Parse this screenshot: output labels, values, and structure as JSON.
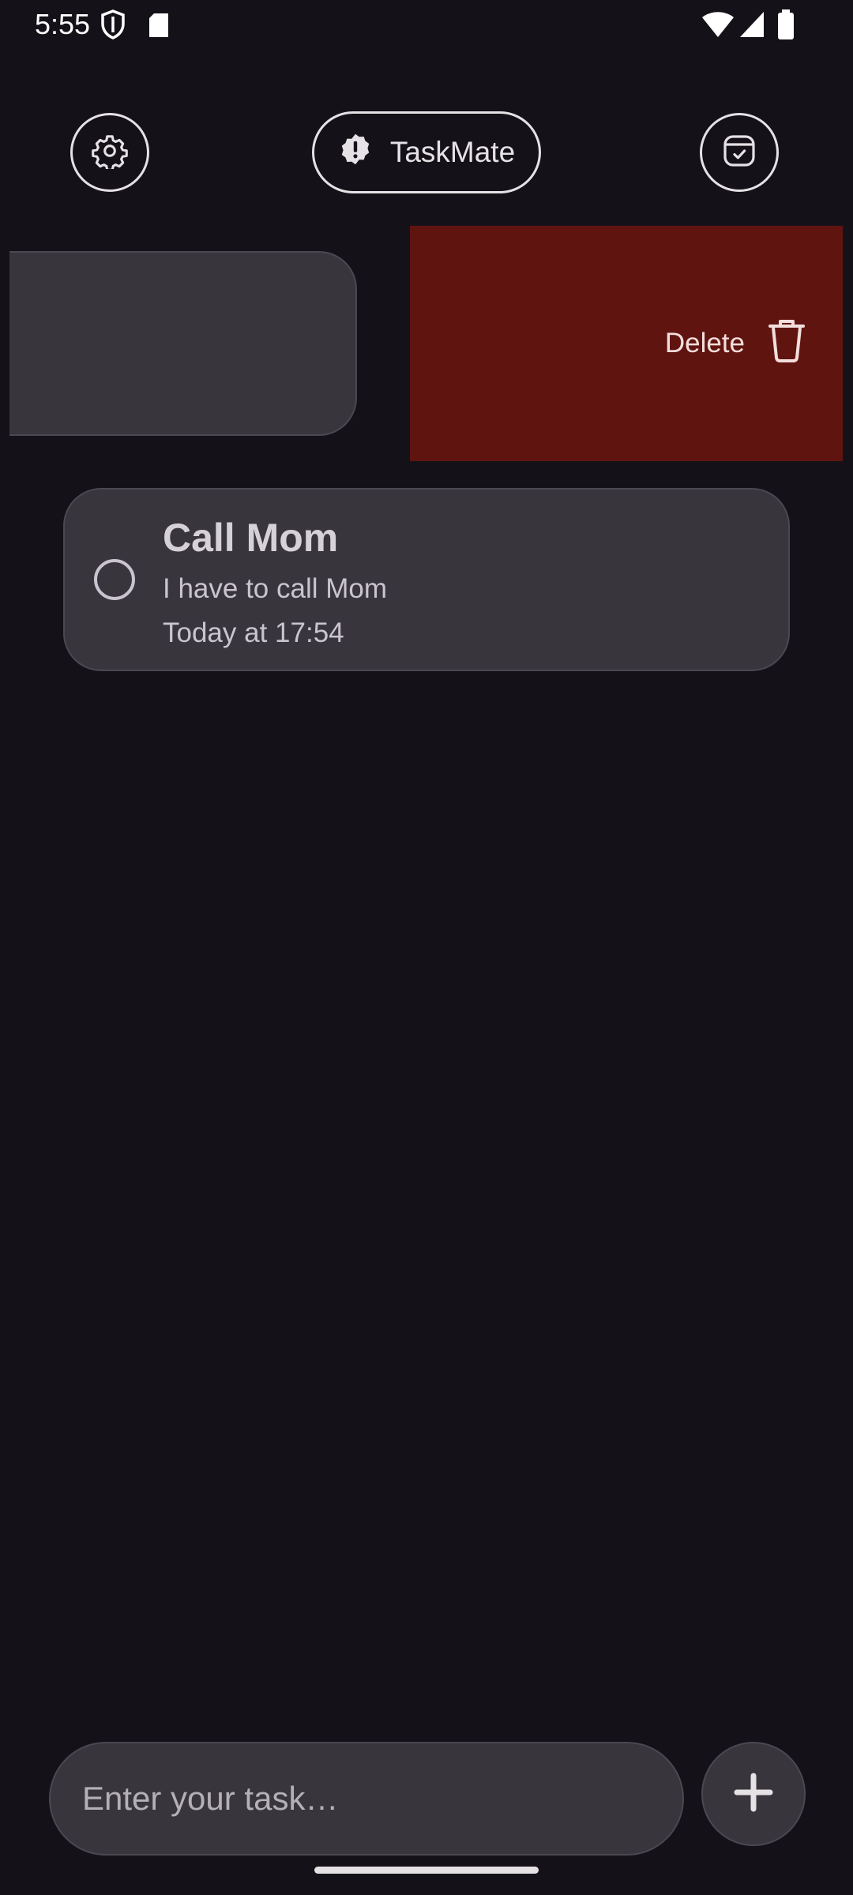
{
  "status_bar": {
    "time": "5:55",
    "icons": [
      "shield-icon",
      "sd-card-icon",
      "wifi-icon",
      "signal-icon",
      "battery-icon"
    ]
  },
  "header": {
    "settings_icon": "gear-icon",
    "app_title": "TaskMate",
    "app_icon": "alert-badge-icon",
    "calendar_icon": "calendar-check-icon"
  },
  "swipe_action": {
    "label": "Delete",
    "icon": "trash-icon",
    "color": "#601410"
  },
  "tasks": [
    {
      "title": "Call Mom",
      "description": "I have to call Mom",
      "due": "Today at 17:54",
      "completed": false
    }
  ],
  "composer": {
    "placeholder": "Enter your task…",
    "add_icon": "plus-icon"
  },
  "colors": {
    "background": "#141218",
    "card": "#38363C",
    "delete": "#601410",
    "foreground": "#E6E1E5"
  }
}
